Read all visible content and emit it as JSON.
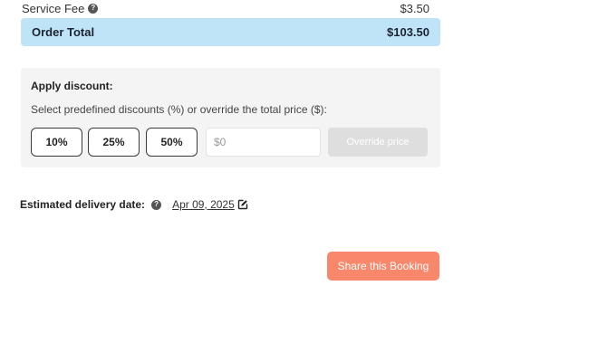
{
  "summary": {
    "service_fee_label": "Service Fee",
    "service_fee_amount": "$3.50",
    "order_total_label": "Order Total",
    "order_total_amount": "$103.50"
  },
  "discount": {
    "title": "Apply discount:",
    "description": "Select predefined discounts (%) or override the total price ($):",
    "options": [
      "10%",
      "25%",
      "50%"
    ],
    "override_placeholder": "$0",
    "override_button_label": "Override price"
  },
  "delivery": {
    "label": "Estimated delivery date:",
    "date": "Apr 09, 2025"
  },
  "actions": {
    "share_label": "Share this Booking"
  },
  "icons": {
    "help": "question-circle-icon",
    "edit": "edit-icon"
  },
  "colors": {
    "order_total_bg": "#bfe3f7",
    "share_button": "#f8876c",
    "panel_bg": "#f4f4f4",
    "override_button_disabled": "#dedede"
  }
}
